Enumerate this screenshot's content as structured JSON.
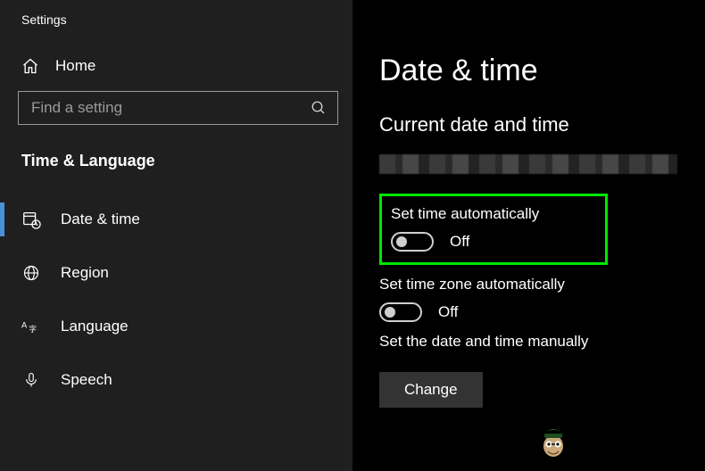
{
  "window": {
    "title": "Settings"
  },
  "sidebar": {
    "home_label": "Home",
    "search_placeholder": "Find a setting",
    "category": "Time & Language",
    "items": [
      {
        "label": "Date & time",
        "icon": "calendar",
        "selected": true
      },
      {
        "label": "Region",
        "icon": "globe",
        "selected": false
      },
      {
        "label": "Language",
        "icon": "language",
        "selected": false
      },
      {
        "label": "Speech",
        "icon": "mic",
        "selected": false
      }
    ]
  },
  "main": {
    "page_title": "Date & time",
    "section_current": "Current date and time",
    "set_time_auto": {
      "label": "Set time automatically",
      "state": "Off"
    },
    "set_tz_auto": {
      "label": "Set time zone automatically",
      "state": "Off"
    },
    "set_manual": {
      "label": "Set the date and time manually",
      "button": "Change"
    }
  }
}
